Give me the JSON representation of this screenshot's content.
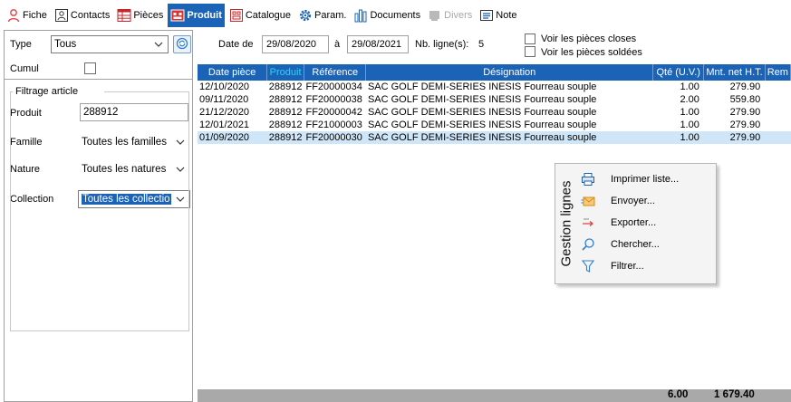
{
  "toolbar": {
    "items": [
      {
        "label": "Fiche",
        "icon": "person-outline-icon",
        "state": "normal"
      },
      {
        "label": "Contacts",
        "icon": "contacts-icon",
        "state": "normal"
      },
      {
        "label": "Pièces",
        "icon": "documents-grid-icon",
        "state": "normal"
      },
      {
        "label": "Produit",
        "icon": "product-icon",
        "state": "active"
      },
      {
        "label": "Catalogue",
        "icon": "catalog-icon",
        "state": "normal"
      },
      {
        "label": "Param.",
        "icon": "gear-icon",
        "state": "normal"
      },
      {
        "label": "Documents",
        "icon": "bar-chart-icon",
        "state": "normal"
      },
      {
        "label": "Divers",
        "icon": "misc-icon",
        "state": "disabled"
      },
      {
        "label": "Note",
        "icon": "note-icon",
        "state": "normal"
      }
    ]
  },
  "filters": {
    "type_label": "Type",
    "type_value": "Tous",
    "cumul_label": "Cumul",
    "group_title": "Filtrage article",
    "produit_label": "Produit",
    "produit_value": "288912",
    "famille_label": "Famille",
    "famille_value": "Toutes les familles",
    "nature_label": "Nature",
    "nature_value": "Toutes les natures",
    "collection_label": "Collection",
    "collection_value": "Toutes les collectio"
  },
  "period": {
    "date_label": "Date de",
    "date_from": "29/08/2020",
    "to_label": "à",
    "date_to": "29/08/2021",
    "count_label": "Nb. ligne(s):",
    "count_value": "5",
    "closed_label": "Voir les pièces closes",
    "settled_label": "Voir les pièces soldées"
  },
  "grid": {
    "columns": [
      "Date pièce",
      "Produit",
      "Référence",
      "Désignation",
      "Qté (U.V.)",
      "Mnt. net H.T.",
      "Rem"
    ],
    "sorted_column": "Produit",
    "rows": [
      [
        "12/10/2020",
        "288912",
        "FF20000034",
        "SAC GOLF DEMI-SERIES INESIS Fourreau souple",
        "1.00",
        "279.90"
      ],
      [
        "09/11/2020",
        "288912",
        "FF20000038",
        "SAC GOLF DEMI-SERIES INESIS Fourreau souple",
        "2.00",
        "559.80"
      ],
      [
        "21/12/2020",
        "288912",
        "FF20000042",
        "SAC GOLF DEMI-SERIES INESIS Fourreau souple",
        "1.00",
        "279.90"
      ],
      [
        "12/01/2021",
        "288912",
        "FF21000003",
        "SAC GOLF DEMI-SERIES INESIS Fourreau souple",
        "1.00",
        "279.90"
      ],
      [
        "01/09/2020",
        "288912",
        "FF20000030",
        "SAC GOLF DEMI-SERIES INESIS Fourreau souple",
        "1.00",
        "279.90"
      ]
    ],
    "selected_row": 4,
    "total_qty": "6.00",
    "total_amount": "1 679.40"
  },
  "context_menu": {
    "title": "Gestion lignes",
    "items": [
      {
        "label": "Imprimer liste...",
        "icon": "printer-icon"
      },
      {
        "label": "Envoyer...",
        "icon": "envelope-icon"
      },
      {
        "label": "Exporter...",
        "icon": "export-arrow-icon"
      },
      {
        "label": "Chercher...",
        "icon": "magnifier-icon"
      },
      {
        "label": "Filtrer...",
        "icon": "funnel-icon"
      }
    ]
  },
  "colors": {
    "accent": "#1b63b7",
    "sorted_header": "#24d6f0",
    "selected_row": "#cfe6f8",
    "footer": "#a9a9a9"
  }
}
